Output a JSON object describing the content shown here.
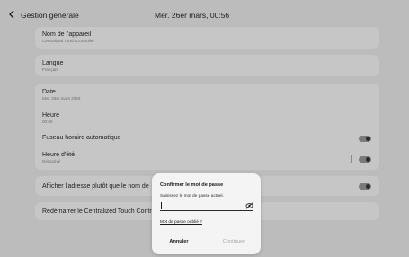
{
  "header": {
    "title": "Gestion générale",
    "datetime": "Mer. 26er mars, 00:56"
  },
  "settings": {
    "device_name": {
      "title": "Nom de l'appareil",
      "value": "Centralized Touch Controller"
    },
    "language": {
      "title": "Langue",
      "value": "Français"
    },
    "date": {
      "title": "Date",
      "value": "Mer. 26er mars 2025"
    },
    "time": {
      "title": "Heure",
      "value": "00:56"
    },
    "auto_timezone": {
      "title": "Fuseau horaire automatique",
      "enabled": false
    },
    "dst": {
      "title": "Heure d'été",
      "value": "Désactivé",
      "enabled": false
    },
    "show_address": {
      "title": "Afficher l'adresse plutôt que le nom de",
      "enabled": false
    },
    "restart": {
      "title": "Redémarrer le Centralized Touch Contro"
    }
  },
  "dialog": {
    "title": "Confirmer le mot de passe",
    "message": "Saisissez le mot de passe actuel.",
    "password_value": "",
    "forgot_link": "Mot de passe oublié ?",
    "cancel_label": "Annuler",
    "continue_label": "Continuer"
  },
  "colors": {
    "background": "#bcbcbc",
    "card": "#c6c6c6",
    "dialog": "#f4f4f4",
    "toggle_off": "#7a7a7a"
  }
}
